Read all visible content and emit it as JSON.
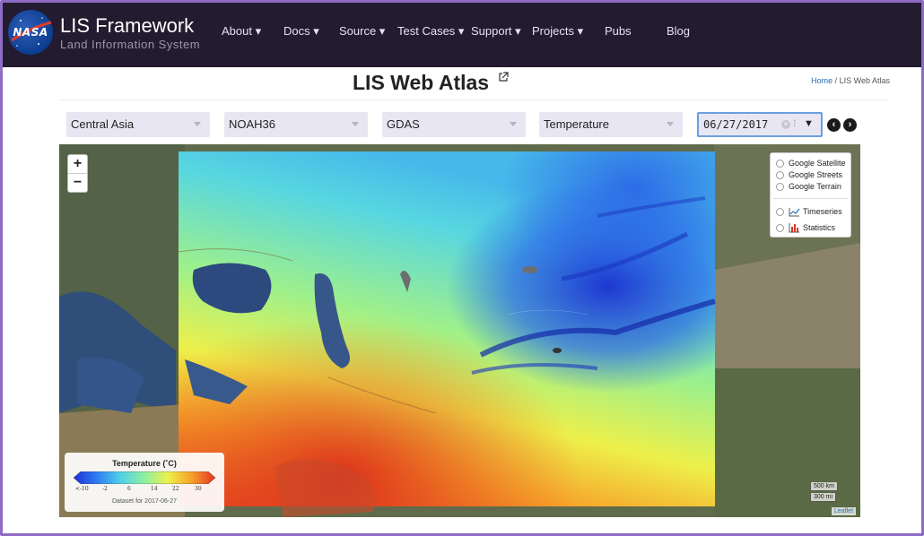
{
  "brand": {
    "logo_text": "NASA",
    "title": "LIS Framework",
    "subtitle": "Land Information System"
  },
  "nav": {
    "about": "About ▾",
    "docs": "Docs ▾",
    "source": "Source ▾",
    "test_cases": "Test Cases ▾",
    "support": "Support ▾",
    "projects": "Projects ▾",
    "pubs": "Pubs",
    "blog": "Blog"
  },
  "page": {
    "title": "LIS Web Atlas",
    "title_icon": "external-link-icon"
  },
  "breadcrumb": {
    "home": "Home",
    "separator": " / ",
    "current": "LIS Web Atlas"
  },
  "controls": {
    "region": "Central Asia",
    "model": "NOAH36",
    "forcing": "GDAS",
    "variable": "Temperature",
    "date_value": "06/27/2017",
    "prev_icon": "chevron-left-circle-icon",
    "next_icon": "chevron-right-circle-icon"
  },
  "map": {
    "zoom_in": "+",
    "zoom_out": "−",
    "layers": {
      "google_satellite": "Google Satellite",
      "google_streets": "Google Streets",
      "google_terrain": "Google Terrain",
      "timeseries": "Timeseries",
      "statistics": "Statistics"
    },
    "legend": {
      "title": "Temperature (˚C)",
      "ticks": [
        "<-10",
        "-2",
        "6",
        "14",
        "22",
        "30"
      ],
      "note": "Dataset for 2017-06-27",
      "colors": [
        "#1d30d8",
        "#2f7ff2",
        "#4fd1e8",
        "#8ef0a0",
        "#eef04a",
        "#f7a22a",
        "#e5321f"
      ]
    },
    "scale_km": "500 km",
    "scale_mi": "300 mi",
    "attribution": "Leaflet"
  },
  "colors": {
    "navbar_bg": "#231b2f",
    "frame_border": "#8e6bc4",
    "select_bg": "#e8e6f3",
    "link": "#2a6db0"
  }
}
